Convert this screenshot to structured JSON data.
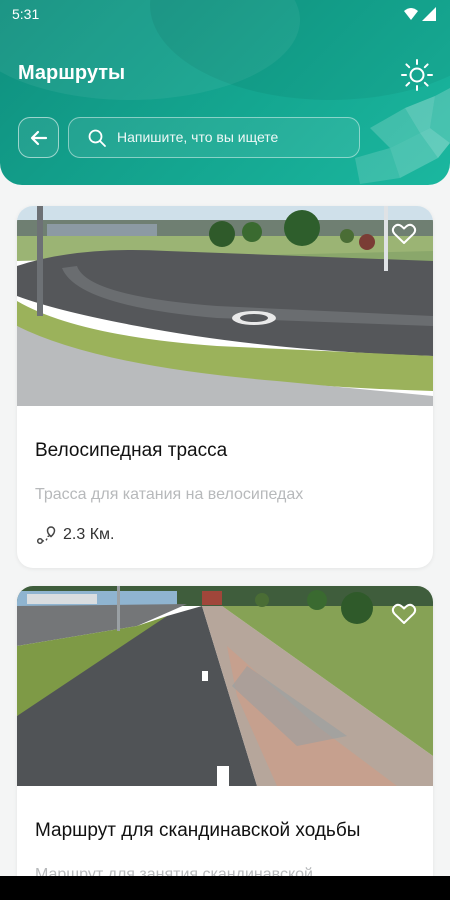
{
  "status_bar": {
    "time": "5:31",
    "icons": [
      "wifi-icon",
      "signal-icon"
    ]
  },
  "header": {
    "title": "Маршруты",
    "theme_icon": "sun-icon",
    "back_icon": "arrow-left-icon",
    "search": {
      "icon": "search-icon",
      "placeholder": "Напишите, что вы ищете",
      "value": ""
    }
  },
  "routes": [
    {
      "title": "Велосипедная трасса",
      "description": "Трасса для катания на велосипедах",
      "distance": "2.3 Км.",
      "distance_icon": "route-icon",
      "favorite_icon": "heart-outline-icon",
      "image": "cycling-track-photo"
    },
    {
      "title": "Маршрут для скандинавской ходьбы",
      "description": "Маршрут для занятия скандинавской",
      "favorite_icon": "heart-outline-icon",
      "image": "walking-path-photo"
    }
  ],
  "colors": {
    "header": "#14a690",
    "background": "#f4f5f5",
    "card": "#ffffff",
    "muted_text": "#b7b9bb"
  }
}
